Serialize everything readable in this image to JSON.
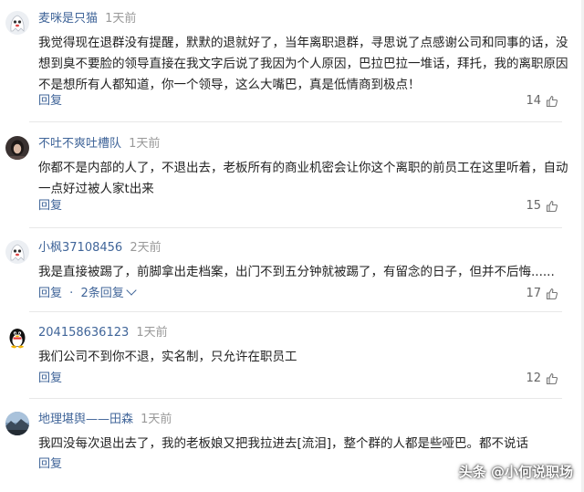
{
  "reply_label": "回复",
  "comments": [
    {
      "username": "麦咪是只猫",
      "time": "1天前",
      "content": "我觉得现在退群没有提醒，默默的退就好了，当年离职退群，寻思说了点感谢公司和同事的话，没想到臭不要脸的领导直接在我文字后说了我因为个人原因，巴拉巴拉一堆话，拜托，我的离职原因不是想所有人都知道，你一个领导，这么大嘴巴，真是低情商到极点！",
      "likes": "14",
      "avatar_icon": "cartoon-ghost-avatar-icon"
    },
    {
      "username": "不吐不爽吐槽队",
      "time": "1天前",
      "content": "你都不是内部的人了，不退出去，老板所有的商业机密会让你这个离职的前员工在这里听着，自动一点好过被人家t出来",
      "likes": "15",
      "avatar_icon": "girl-photo-avatar-icon"
    },
    {
      "username": "小枫37108456",
      "time": "2天前",
      "content": "我是直接被踢了，前脚拿出走档案，出门不到五分钟就被踢了，有留念的日子，但并不后悔......",
      "likes": "17",
      "more_replies": "2条回复",
      "avatar_icon": "cartoon-ghost-avatar-icon"
    },
    {
      "username": "204158636123",
      "time": "1天前",
      "content": "我们公司不到你不退，实名制，只允许在职员工",
      "likes": "12",
      "avatar_icon": "penguin-avatar-icon"
    },
    {
      "username": "地理堪舆——田森",
      "time": "1天前",
      "content": "我四没每次退出去了，我的老板娘又把我拉进去[流泪]，整个群的人都是些哑巴。都不说话",
      "avatar_icon": "landscape-photo-avatar-icon"
    }
  ],
  "watermark": "头条 @小何说职场",
  "colors": {
    "link": "#406599",
    "text": "#222222",
    "meta": "#999999",
    "divider": "#e8e8e8"
  }
}
